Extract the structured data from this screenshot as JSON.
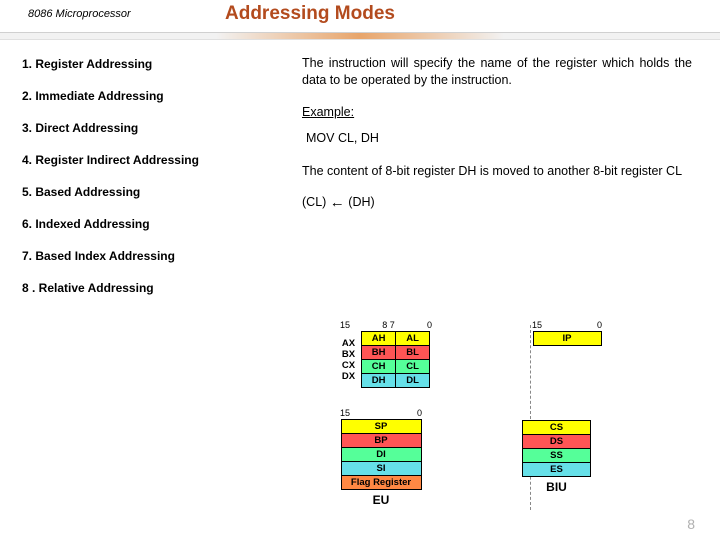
{
  "header": {
    "small": "8086 Microprocessor",
    "title": "Addressing Modes"
  },
  "modes": [
    "1.  Register Addressing",
    "2.  Immediate Addressing",
    "3.  Direct Addressing",
    "4.  Register Indirect Addressing",
    "5.  Based Addressing",
    "6.  Indexed Addressing",
    "7.  Based Index Addressing",
    "8 . Relative Addressing"
  ],
  "right": {
    "desc": "The instruction will specify the name of the register which holds the data to be operated by the instruction.",
    "example_label": "Example:",
    "mov": "MOV CL, DH",
    "desc2": "The content of 8-bit register DH is moved to another 8-bit register CL",
    "assign_left": "(CL)",
    "assign_right": "(DH)"
  },
  "diagram": {
    "top_bits": {
      "l15": "15",
      "l87": "8 7",
      "l0": "0",
      "r15": "15",
      "r0": "0"
    },
    "ax": {
      "hi": "AH",
      "lo": "AL",
      "lbl": "AX"
    },
    "bx": {
      "hi": "BH",
      "lo": "BL",
      "lbl": "BX"
    },
    "cx": {
      "hi": "CH",
      "lo": "CL",
      "lbl": "CX"
    },
    "dx": {
      "hi": "DH",
      "lo": "DL",
      "lbl": "DX"
    },
    "ip": "IP",
    "eu_regs": [
      "SP",
      "BP",
      "DI",
      "SI",
      "Flag Register"
    ],
    "biu_regs": [
      "CS",
      "DS",
      "SS",
      "ES"
    ],
    "eu_label": "EU",
    "biu_label": "BIU"
  },
  "page": "8"
}
